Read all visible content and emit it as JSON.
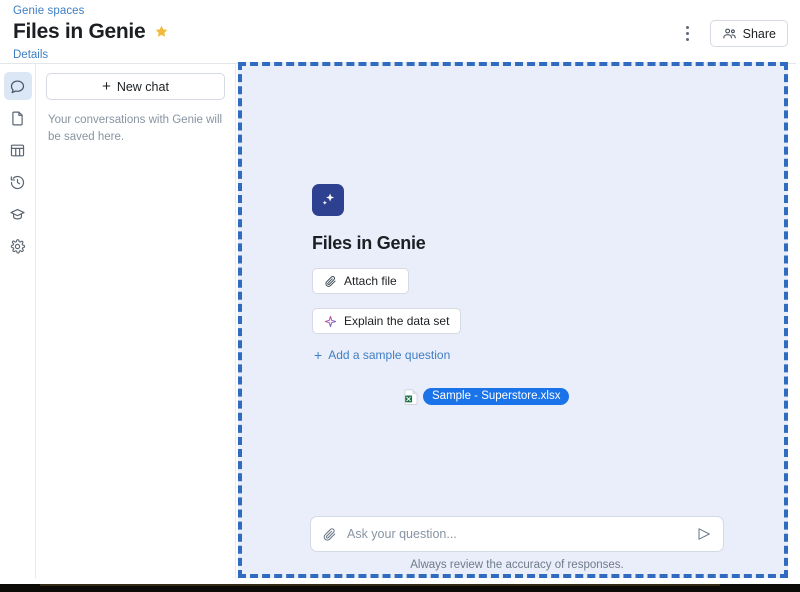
{
  "header": {
    "breadcrumb": "Genie spaces",
    "title": "Files in Genie",
    "star_icon": "star-filled-icon",
    "details_link": "Details",
    "kebab_icon": "more-options-icon",
    "share_label": "Share",
    "share_icon": "people-group-icon"
  },
  "icon_rail": {
    "items": [
      {
        "name": "chat",
        "icon": "chat-bubble-icon",
        "active": true
      },
      {
        "name": "files",
        "icon": "document-icon",
        "active": false
      },
      {
        "name": "tables",
        "icon": "table-grid-icon",
        "active": false
      },
      {
        "name": "history",
        "icon": "history-clock-icon",
        "active": false
      },
      {
        "name": "learn",
        "icon": "graduation-cap-icon",
        "active": false
      },
      {
        "name": "settings",
        "icon": "gear-icon",
        "active": false
      }
    ]
  },
  "chat_panel": {
    "new_chat_label": "New chat",
    "new_chat_icon": "plus-icon",
    "empty_note": "Your conversations with Genie will be saved here."
  },
  "main": {
    "logo_icon": "genie-sparkle-logo",
    "welcome_title": "Files in Genie",
    "attach_file": {
      "label": "Attach file",
      "icon": "paperclip-icon"
    },
    "explain_data_set": {
      "label": "Explain the data set",
      "icon": "sparkle-icon"
    },
    "add_sample_question": {
      "label": "Add a sample question",
      "icon": "plus-icon"
    },
    "file_chip": {
      "label": "Sample - Superstore.xlsx",
      "icon": "excel-file-icon",
      "selected": true
    },
    "composer": {
      "attach_icon": "paperclip-icon",
      "placeholder": "Ask your question...",
      "send_icon": "send-paper-plane-icon"
    },
    "disclaimer": "Always review the accuracy of responses."
  },
  "colors": {
    "panel_background": "#eaeefa",
    "dashed_border": "#2f6cc0",
    "link": "#3f7ec4",
    "logo_background": "#2e4090",
    "star": "#f2b93c",
    "chip_background": "#1a73e8",
    "excel_green": "#1e7145"
  }
}
